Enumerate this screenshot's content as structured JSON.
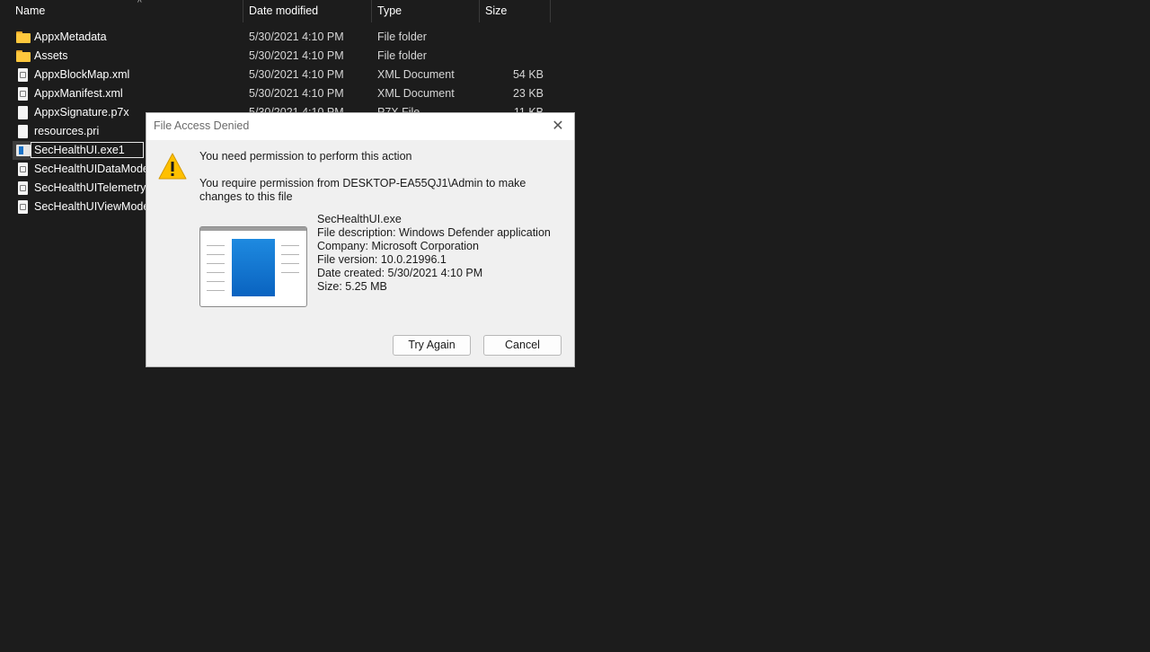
{
  "explorer": {
    "columns": {
      "name": "Name",
      "date": "Date modified",
      "type": "Type",
      "size": "Size"
    },
    "rows": [
      {
        "name": "AppxMetadata",
        "date": "5/30/2021 4:10 PM",
        "type": "File folder",
        "size": "",
        "icon": "folder-icon"
      },
      {
        "name": "Assets",
        "date": "5/30/2021 4:10 PM",
        "type": "File folder",
        "size": "",
        "icon": "folder-icon"
      },
      {
        "name": "AppxBlockMap.xml",
        "date": "5/30/2021 4:10 PM",
        "type": "XML Document",
        "size": "54 KB",
        "icon": "xml-file-icon"
      },
      {
        "name": "AppxManifest.xml",
        "date": "5/30/2021 4:10 PM",
        "type": "XML Document",
        "size": "23 KB",
        "icon": "xml-file-icon"
      },
      {
        "name": "AppxSignature.p7x",
        "date": "5/30/2021 4:10 PM",
        "type": "P7X File",
        "size": "11 KB",
        "icon": "file-icon"
      },
      {
        "name": "resources.pri",
        "date": "",
        "type": "",
        "size": "",
        "icon": "file-icon"
      },
      {
        "name": "SecHealthUI.exe1",
        "date": "",
        "type": "",
        "size": "",
        "icon": "exe-icon",
        "renaming": true
      },
      {
        "name": "SecHealthUIDataModel.",
        "date": "",
        "type": "",
        "size": "",
        "icon": "dll-file-icon"
      },
      {
        "name": "SecHealthUITelemetry.d",
        "date": "",
        "type": "",
        "size": "",
        "icon": "dll-file-icon"
      },
      {
        "name": "SecHealthUIViewModels",
        "date": "",
        "type": "",
        "size": "",
        "icon": "dll-file-icon"
      }
    ]
  },
  "dialog": {
    "title": "File Access Denied",
    "close_glyph": "✕",
    "message": "You need permission to perform this action",
    "detail": "You require permission from DESKTOP-EA55QJ1\\Admin to make changes to this file",
    "file_name": "SecHealthUI.exe",
    "file_description": "File description: Windows Defender application",
    "company": "Company: Microsoft Corporation",
    "file_version": "File version: 10.0.21996.1",
    "date_created": "Date created: 5/30/2021 4:10 PM",
    "size": "Size: 5.25 MB",
    "try_again_label": "Try Again",
    "cancel_label": "Cancel"
  },
  "colors": {
    "background": "#1c1c1c",
    "dialog_bg": "#f0f0f0",
    "warning": "#ffc000",
    "folder": "#ffc83d",
    "accent_blue": "#0a63c0"
  }
}
